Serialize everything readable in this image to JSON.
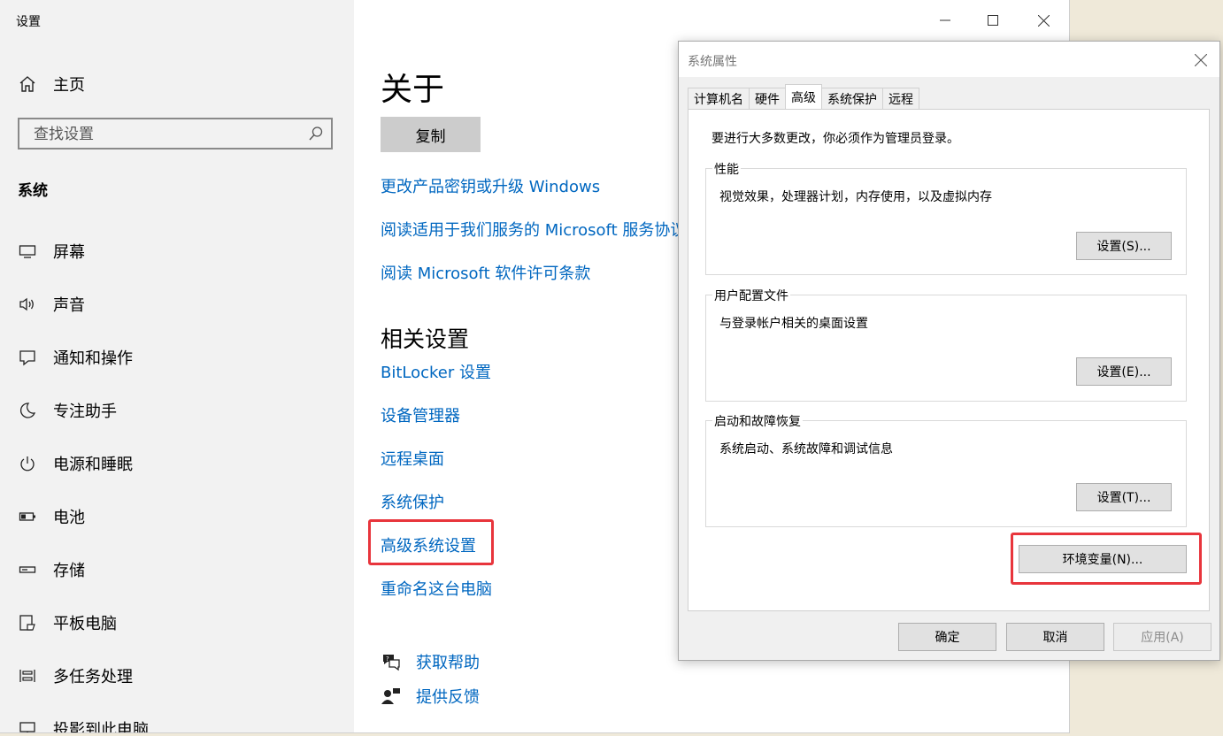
{
  "settings": {
    "app_title": "设置",
    "home": "主页",
    "search_placeholder": "查找设置",
    "section": "系统",
    "nav": [
      "屏幕",
      "声音",
      "通知和操作",
      "专注助手",
      "电源和睡眠",
      "电池",
      "存储",
      "平板电脑",
      "多任务处理",
      "投影到此电脑"
    ],
    "about_title": "关于",
    "copy_button": "复制",
    "links": [
      "更改产品密钥或升级 Windows",
      "阅读适用于我们服务的 Microsoft 服务协议",
      "阅读 Microsoft 软件许可条款"
    ],
    "related_title": "相关设置",
    "related_links": [
      "BitLocker 设置",
      "设备管理器",
      "远程桌面",
      "系统保护",
      "高级系统设置",
      "重命名这台电脑"
    ],
    "help": "获取帮助",
    "feedback": "提供反馈",
    "highlight_color": "#e8353c",
    "link_color": "#0067c0"
  },
  "dialog": {
    "title": "系统属性",
    "tabs": [
      "计算机名",
      "硬件",
      "高级",
      "系统保护",
      "远程"
    ],
    "active_tab": "高级",
    "notice": "要进行大多数更改，你必须作为管理员登录。",
    "performance": {
      "title": "性能",
      "desc": "视觉效果，处理器计划，内存使用，以及虚拟内存",
      "button": "设置(S)..."
    },
    "profiles": {
      "title": "用户配置文件",
      "desc": "与登录帐户相关的桌面设置",
      "button": "设置(E)..."
    },
    "startup": {
      "title": "启动和故障恢复",
      "desc": "系统启动、系统故障和调试信息",
      "button": "设置(T)..."
    },
    "env_button": "环境变量(N)...",
    "ok": "确定",
    "cancel": "取消",
    "apply": "应用(A)"
  }
}
